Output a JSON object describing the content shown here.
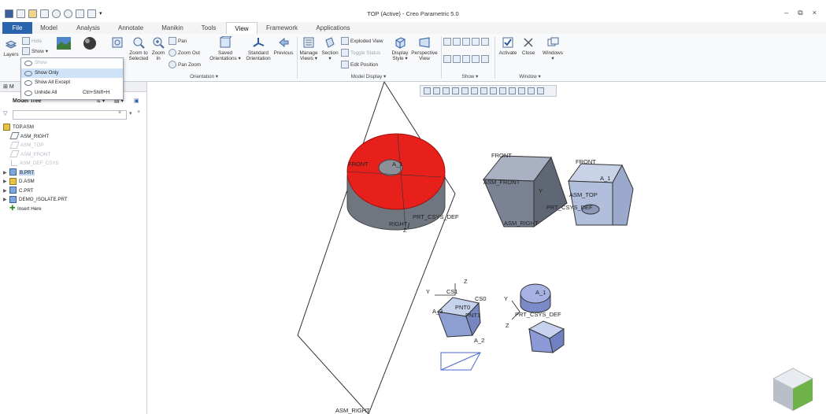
{
  "window": {
    "title": "TOP (Active) - Creo Parametric 5.0"
  },
  "tabs": [
    "File",
    "Model",
    "Analysis",
    "Annotate",
    "Manikin",
    "Tools",
    "View",
    "Framework",
    "Applications"
  ],
  "ribbon": {
    "layers": "Layers",
    "hide": "Hide",
    "show": "Show",
    "zoom_selected": [
      "Zoom to",
      "Selected"
    ],
    "zoom_in": [
      "Zoom",
      "In"
    ],
    "pan": "Pan",
    "zoom_out": "Zoom Out",
    "pan_zoom": "Pan Zoom",
    "saved_orient": [
      "Saved",
      "Orientations ▾"
    ],
    "standard_orient": [
      "Standard",
      "Orientation"
    ],
    "previous": "Previous",
    "manage_views": [
      "Manage",
      "Views ▾"
    ],
    "section": [
      "Section",
      "▾"
    ],
    "exploded_view": "Exploded View",
    "toggle_status": "Toggle Status",
    "edit_position": "Edit Position",
    "display_style": [
      "Display",
      "Style ▾"
    ],
    "perspective_view": [
      "Perspective",
      "View"
    ],
    "activate": "Activate",
    "close": "Close",
    "windows": [
      "Windows",
      "▾"
    ],
    "group_orientation": "Orientation ▾",
    "group_model_display": "Model Display ▾",
    "group_show": "Show ▾",
    "group_window": "Window ▾"
  },
  "show_menu": {
    "items": [
      {
        "label": "Show",
        "shortcut": ""
      },
      {
        "label": "Show Only",
        "shortcut": ""
      },
      {
        "label": "Show All Except",
        "shortcut": ""
      },
      {
        "label": "Unhide All",
        "shortcut": "Ctrl+Shift+H"
      }
    ]
  },
  "model_tree": {
    "tab_label": "M",
    "title": "Model Tree",
    "items": [
      {
        "label": "TOP.ASM"
      },
      {
        "label": "ASM_RIGHT"
      },
      {
        "label": "ASM_TOP"
      },
      {
        "label": "ASM_FRONT"
      },
      {
        "label": "ASM_DEF_CSYS"
      },
      {
        "label": "B.PRT"
      },
      {
        "label": "D.ASM"
      },
      {
        "label": "C.PRT"
      },
      {
        "label": "DEMO_ISOLATE.PRT"
      },
      {
        "label": "Insert Here"
      }
    ]
  },
  "viewport_labels": {
    "front1": "FRONT",
    "a1_1": "A_1",
    "right1": "RIGHT",
    "z1": "Z",
    "prt_csys1": "PRT_CSYS_DEF",
    "front2": "FRONT",
    "asm_front": "ASM_FRONT",
    "y2": "Y",
    "prt_csys2": "PRT_CSYS_DEF",
    "asm_right2": "ASM_RIGHT",
    "front3": "FRONT",
    "a1_3": "A_1",
    "asm_top": "ASM_TOP",
    "y4": "Y",
    "cs1": "CS1",
    "z4": "Z",
    "cs0": "CS0",
    "pnt0": "PNT0",
    "pnt1": "PNT1",
    "a3": "A_3",
    "a2": "A_2",
    "a1_5": "A_1",
    "y5": "Y",
    "prt_csys5": "PRT_CSYS_DEF",
    "z5": "Z",
    "asm_right": "ASM_RIGHT"
  },
  "colors": {
    "accent": "#2a64ae",
    "red_part": "#e8201c",
    "blue_part": "#a9b9dd",
    "dark_part": "#6f7480"
  }
}
